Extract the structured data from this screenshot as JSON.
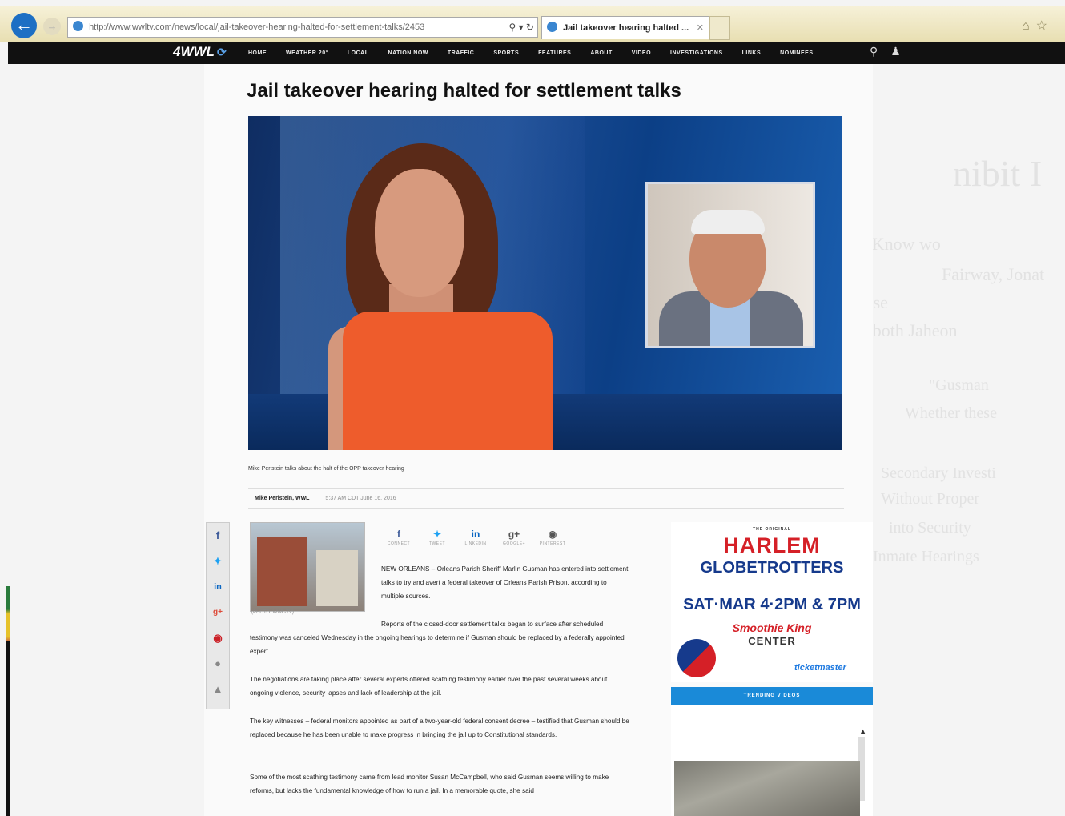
{
  "browser": {
    "url": "http://www.wwltv.com/news/local/jail-takeover-hearing-halted-for-settlement-talks/2453",
    "tab_title": "Jail takeover hearing halted ..."
  },
  "nav": {
    "logo": "4WWL",
    "items": [
      "HOME",
      "WEATHER 20°",
      "LOCAL",
      "NATION NOW",
      "TRAFFIC",
      "SPORTS",
      "FEATURES",
      "ABOUT",
      "VIDEO",
      "INVESTIGATIONS",
      "LINKS",
      "NOMINEES"
    ]
  },
  "article": {
    "title": "Jail takeover hearing halted for settlement talks",
    "video_caption": "Mike Perlstein talks about the halt of the OPP takeover hearing",
    "byline": "Mike Perlstein, WWL",
    "timestamp": "5:37 AM CDT June 16, 2016",
    "thumb_caption": "(PHOTO: WWL-TV)",
    "share": [
      {
        "icon": "f",
        "label": "CONNECT"
      },
      {
        "icon": "t",
        "label": "TWEET"
      },
      {
        "icon": "in",
        "label": "LINKEDIN"
      },
      {
        "icon": "g+",
        "label": "GOOGLE+"
      },
      {
        "icon": "p",
        "label": "PINTEREST"
      }
    ],
    "paragraphs": [
      "NEW ORLEANS – Orleans Parish Sheriff Marlin Gusman has entered into settlement talks to try and avert a federal takeover of Orleans Parish Prison, according to multiple sources.",
      "Reports of the closed-door settlement talks began to surface after scheduled testimony was canceled Wednesday in the ongoing hearings to determine if Gusman should be replaced by a federally appointed expert.",
      "The negotiations are taking place after several experts offered scathing testimony earlier over the past several weeks about ongoing violence, security lapses and lack of leadership at the jail.",
      "The key witnesses – federal monitors appointed as part of a two-year-old federal consent decree – testified that Gusman should be replaced because he has been unable to make progress in bringing the jail up to Constitutional standards.",
      "Some of the most scathing testimony came from lead monitor Susan McCampbell, who said Gusman seems willing to make reforms, but lacks the fundamental knowledge of how to run a jail. In a memorable quote, she said"
    ]
  },
  "ad": {
    "eyebrow": "THE ORIGINAL",
    "line1": "HARLEM",
    "line2": "GLOBETROTTERS",
    "date": "SAT·MAR 4·2PM & 7PM",
    "venue1": "Smoothie King",
    "venue2": "CENTER",
    "vendor": "ticketmaster"
  },
  "trending": {
    "label": "TRENDING VIDEOS"
  },
  "colors": {
    "nav_bg": "#111111",
    "accent_blue": "#1a8ad8",
    "ad_red": "#d52027",
    "ad_navy": "#163a8c"
  }
}
